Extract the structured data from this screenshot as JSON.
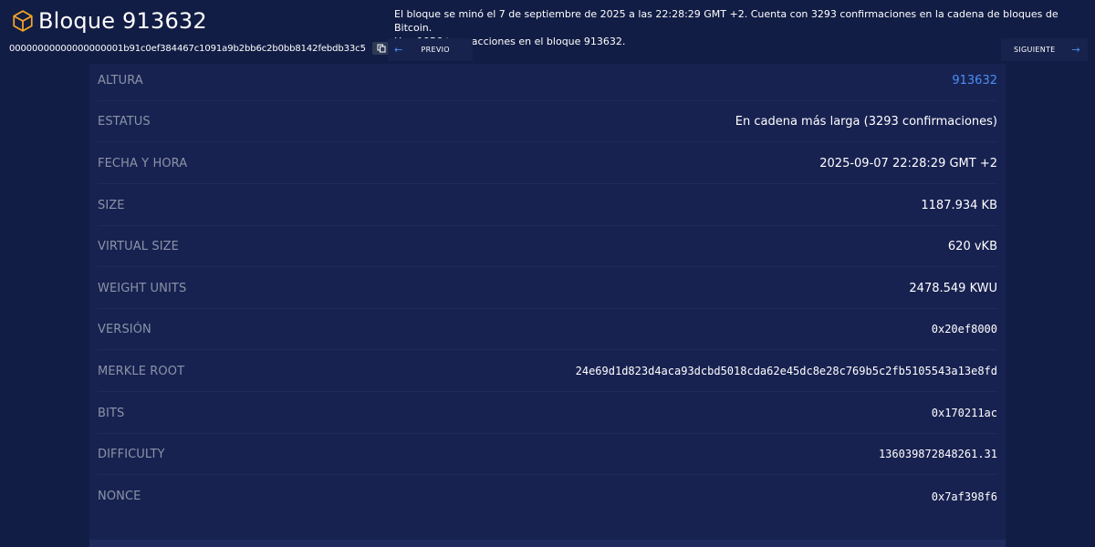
{
  "header": {
    "title": "Bloque 913632",
    "hash": "00000000000000000001b91c0ef384467c1091a9b2bb6c2b0bb8142febdb33c5",
    "description_line1": "El bloque se minó el 7 de septiembre de 2025 a las 22:28:29 GMT +2. Cuenta con 3293 confirmaciones en la cadena de bloques de Bitcoin.",
    "description_line2": "Hay 1956 transacciones en el bloque 913632.",
    "prev_label": "PREVIO",
    "next_label": "SIGUIENTE"
  },
  "icons": {
    "cube": "cube-icon",
    "copy": "copy-icon",
    "prev_arrow": "arrow-left-icon",
    "next_arrow": "arrow-right-icon"
  },
  "colors": {
    "background": "#121d45",
    "panel": "#182251",
    "accent_cube": "#f7a823",
    "link": "#4a8ef2",
    "label": "#8b93a7"
  },
  "details": [
    {
      "label": "ALTURA",
      "value": "913632"
    },
    {
      "label": "ESTATUS",
      "value": "En cadena más larga (3293 confirmaciones)"
    },
    {
      "label": "FECHA Y HORA",
      "value": "2025-09-07 22:28:29 GMT +2"
    },
    {
      "label": "SIZE",
      "value": "1187.934 KB"
    },
    {
      "label": "VIRTUAL SIZE",
      "value": "620 vKB"
    },
    {
      "label": "WEIGHT UNITS",
      "value": "2478.549 KWU"
    },
    {
      "label": "VERSIÓN",
      "value": "0x20ef8000"
    },
    {
      "label": "MERKLE ROOT",
      "value": "24e69d1d823d4aca93dcbd5018cda62e45dc8e28c769b5c2fb5105543a13e8fd"
    },
    {
      "label": "BITS",
      "value": "0x170211ac"
    },
    {
      "label": "DIFFICULTY",
      "value": "136039872848261.31"
    },
    {
      "label": "NONCE",
      "value": "0x7af398f6"
    }
  ]
}
